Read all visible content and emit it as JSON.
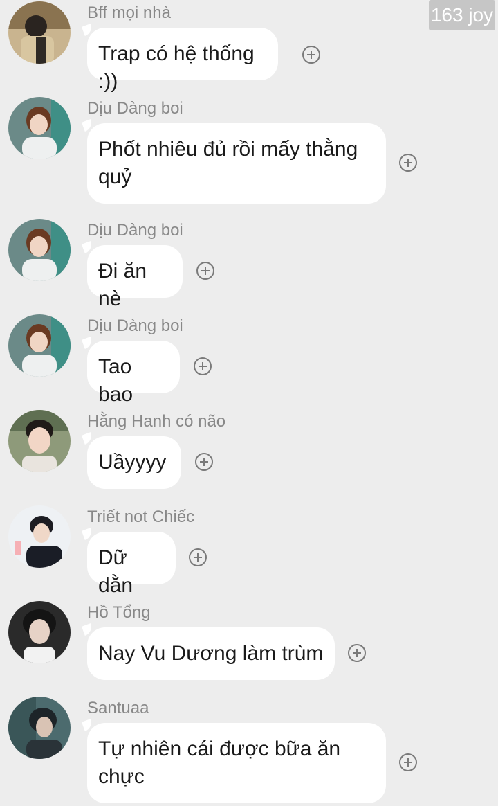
{
  "watermark": "163 joy",
  "messages": [
    {
      "sender": "Bff mọi nhà",
      "text": "Trap có hệ thống :))",
      "avatar": "avatar-1"
    },
    {
      "sender": "Dịu Dàng boi",
      "text": "Phốt nhiêu đủ rồi mấy thằng quỷ",
      "avatar": "avatar-2"
    },
    {
      "sender": "Dịu Dàng boi",
      "text": "Đi ăn nè",
      "avatar": "avatar-2"
    },
    {
      "sender": "Dịu Dàng boi",
      "text": "Tao bao",
      "avatar": "avatar-2"
    },
    {
      "sender": "Hằng Hanh có não",
      "text": "Uầyyyy",
      "avatar": "avatar-3"
    },
    {
      "sender": "Triết not Chiếc",
      "text": "Dữ dằn",
      "avatar": "avatar-4"
    },
    {
      "sender": "Hồ Tổng",
      "text": "Nay Vu Dương làm trùm",
      "avatar": "avatar-5"
    },
    {
      "sender": "Santuaa",
      "text": "Tự nhiên cái được bữa ăn chực",
      "avatar": "avatar-6"
    }
  ],
  "icons": {
    "react": "plus-circle-icon"
  },
  "colors": {
    "background": "#ededed",
    "bubble": "#ffffff",
    "sender_text": "#888888",
    "message_text": "#1a1a1a"
  }
}
